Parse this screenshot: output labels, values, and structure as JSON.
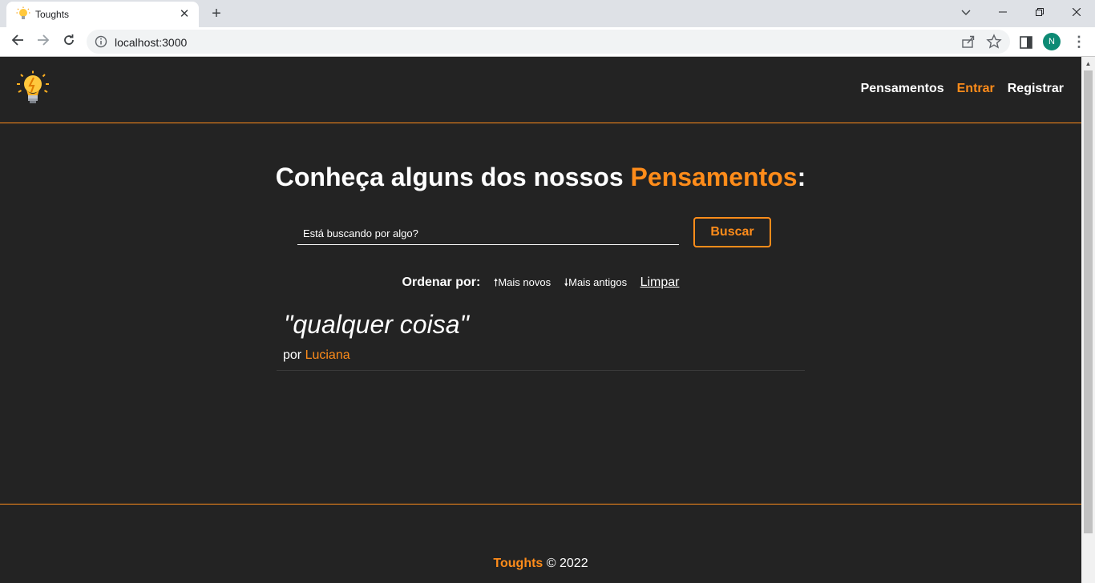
{
  "browser": {
    "tab_title": "Toughts",
    "tab_close": "✕",
    "new_tab": "+",
    "url": "localhost:3000",
    "profile_initial": "N"
  },
  "header": {
    "nav": [
      {
        "label": "Pensamentos"
      },
      {
        "label": "Entrar"
      },
      {
        "label": "Registrar"
      }
    ]
  },
  "main": {
    "headline_prefix": "Conheça alguns dos nossos ",
    "headline_highlight": "Pensamentos",
    "headline_suffix": ":",
    "search_placeholder": "Está buscando por algo?",
    "search_button": "Buscar",
    "order_label": "Ordenar por:",
    "order_newest": "🠕Mais novos",
    "order_oldest": "🠗Mais antigos",
    "order_clear": "Limpar",
    "thoughts": [
      {
        "text": "\"qualquer coisa\"",
        "by": "por ",
        "author": "Luciana"
      }
    ]
  },
  "footer": {
    "brand": "Toughts",
    "copyright": " © 2022"
  },
  "colors": {
    "accent": "#ff8c1a",
    "background": "#232323",
    "text": "#ffffff"
  }
}
